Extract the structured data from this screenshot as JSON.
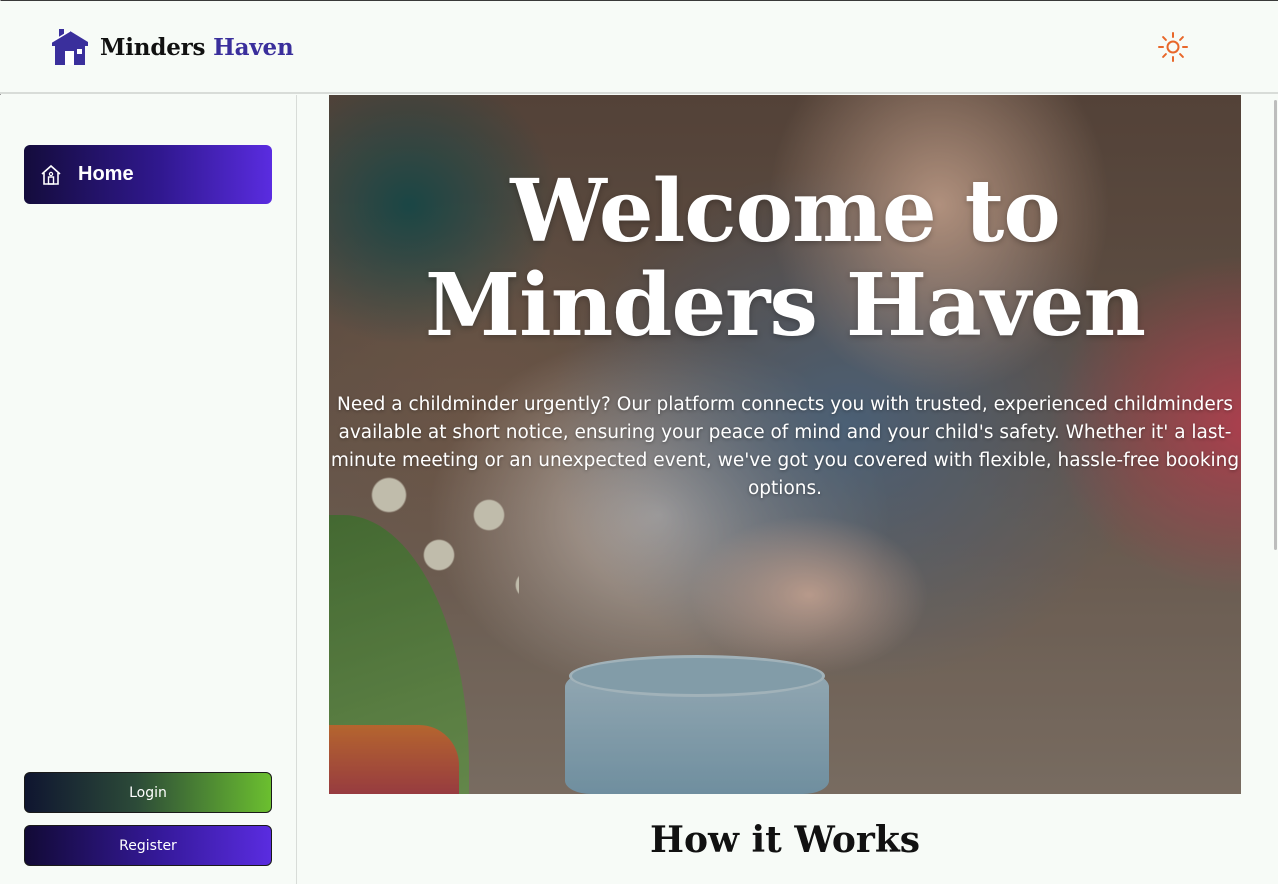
{
  "brand": {
    "name_part1": "Minders",
    "name_part2": "Haven",
    "accent_color": "#3a2f9c",
    "logo_icon": "house-icon"
  },
  "header": {
    "theme_toggle_icon": "sun-icon",
    "theme_toggle_color": "#e8672a"
  },
  "sidebar": {
    "items": [
      {
        "label": "Home",
        "icon": "home-icon",
        "active": true
      }
    ],
    "login_label": "Login",
    "register_label": "Register"
  },
  "hero": {
    "title_line1": "Welcome to",
    "title_line2": "Minders Haven",
    "description": "Need a childminder urgently? Our platform connects you with trusted, experienced childminders available at short notice, ensuring your peace of mind and your child's safety. Whether it' a last-minute meeting or an unexpected event, we've got you covered with flexible, hassle-free booking options."
  },
  "sections": {
    "how_it_works_title": "How it Works"
  }
}
